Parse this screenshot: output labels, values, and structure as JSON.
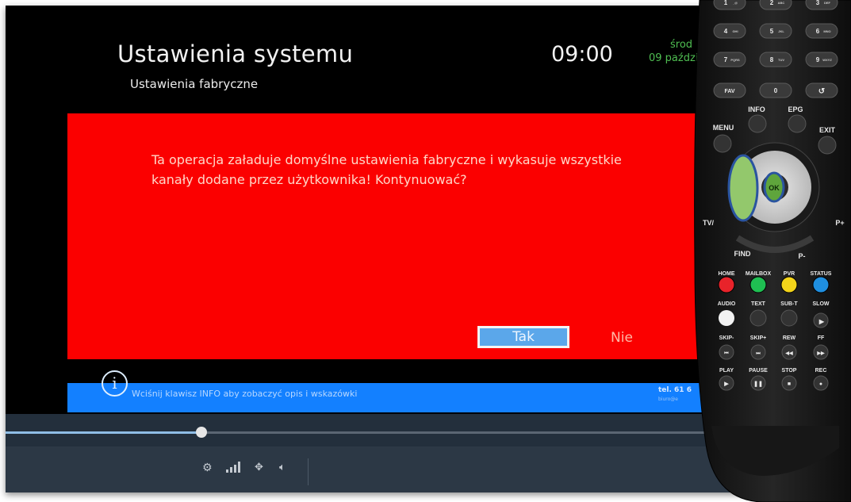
{
  "tv_screen": {
    "title": "Ustawienia systemu",
    "subtitle": "Ustawienia fabryczne",
    "clock": "09:00",
    "day": "środ",
    "date": "09 paździ",
    "dialog": {
      "message": "Ta operacja załaduje domyślne ustawienia fabryczne i wykasuje wszystkie kanały dodane przez użytkownika! Kontynuować?",
      "yes_label": "Tak",
      "no_label": "Nie"
    },
    "help_bar": {
      "info_glyph": "i",
      "text": "Wciśnij klawisz INFO aby zobaczyć opis i wskazówki",
      "contact": "tel. 61 6",
      "contact_small": "biuro@e"
    },
    "colors": {
      "dialog_bg": "#fb0000",
      "help_bar_bg": "#1380ff",
      "selected_button": "#5ba7ea",
      "date_text": "#4fbf52"
    }
  },
  "player": {
    "progress": 0.233,
    "icons": [
      "settings-icon",
      "signal-icon",
      "move-icon",
      "volume-icon"
    ]
  },
  "remote": {
    "number_keys": [
      {
        "num": "1",
        "letters": "_@"
      },
      {
        "num": "2",
        "letters": "ABC"
      },
      {
        "num": "3",
        "letters": "DEF"
      },
      {
        "num": "4",
        "letters": "GHI"
      },
      {
        "num": "5",
        "letters": "JKL"
      },
      {
        "num": "6",
        "letters": "MNO"
      },
      {
        "num": "7",
        "letters": "PQRS"
      },
      {
        "num": "8",
        "letters": "TUV"
      },
      {
        "num": "9",
        "letters": "WXYZ"
      }
    ],
    "fav_label": "FAV",
    "zero_label": "0",
    "recall_glyph": "↺",
    "info_label": "INFO",
    "epg_label": "EPG",
    "menu_label": "MENU",
    "exit_label": "EXIT",
    "ok_label": "OK",
    "tv_label": "TV/",
    "p_plus_label": "P+",
    "find_label": "FIND",
    "p_minus_label": "P-",
    "color_row_labels": [
      "HOME",
      "MAILBOX",
      "PVR",
      "STATUS"
    ],
    "color_row_colors": [
      "#e8232a",
      "#1fbf52",
      "#f3d41a",
      "#1f8fe0"
    ],
    "function_row_labels": [
      "AUDIO",
      "TEXT",
      "SUB-T",
      "SLOW"
    ],
    "skip_row_labels": [
      "SKIP-",
      "SKIP+",
      "REW",
      "FF"
    ],
    "play_row_labels": [
      "PLAY",
      "PAUSE",
      "STOP",
      "REC"
    ],
    "highlight_color": "#2a54a0"
  }
}
